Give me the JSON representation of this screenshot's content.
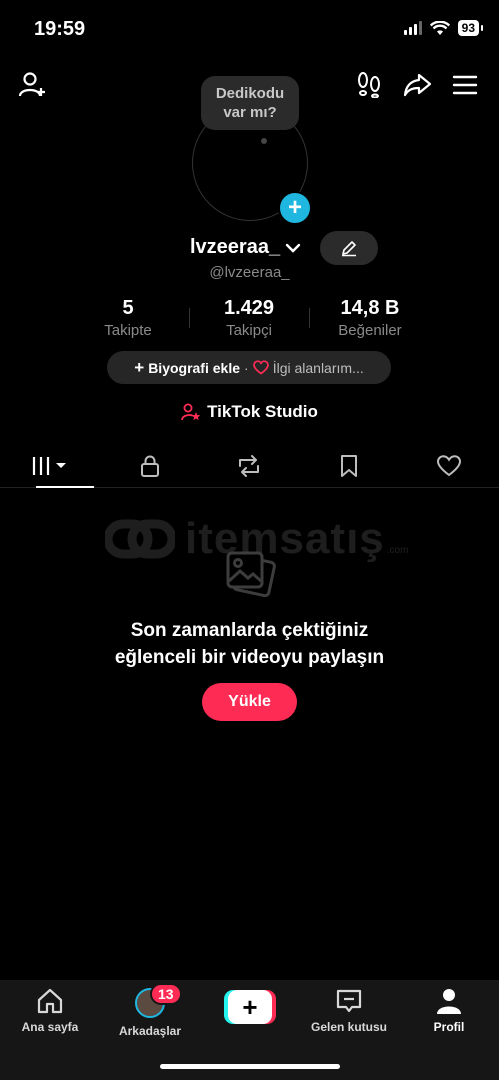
{
  "status_bar": {
    "time": "19:59",
    "battery": "93"
  },
  "bubble": {
    "line1": "Dedikodu",
    "line2": "var mı?"
  },
  "profile": {
    "username": "lvzeeraa_",
    "handle": "@lvzeeraa_",
    "stats": [
      {
        "value": "5",
        "label": "Takipte"
      },
      {
        "value": "1.429",
        "label": "Takipçi"
      },
      {
        "value": "14,8 B",
        "label": "Beğeniler"
      }
    ],
    "bio_button": "Biyografi ekle",
    "bio_sep": "·",
    "interests": "İlgi alanlarım..."
  },
  "studio": {
    "label": "TikTok Studio"
  },
  "watermark": {
    "text": "itemsatış",
    "sub": ".com"
  },
  "empty_state": {
    "line1": "Son zamanlarda çektiğiniz",
    "line2": "eğlenceli bir videoyu paylaşın",
    "button": "Yükle"
  },
  "bottom_nav": {
    "home": "Ana sayfa",
    "friends": "Arkadaşlar",
    "friends_badge": "13",
    "create": "+",
    "inbox": "Gelen kutusu",
    "profile": "Profil"
  },
  "colors": {
    "accent": "#fe2c55",
    "cyan": "#25f4ee",
    "blue": "#1fb6e0"
  }
}
